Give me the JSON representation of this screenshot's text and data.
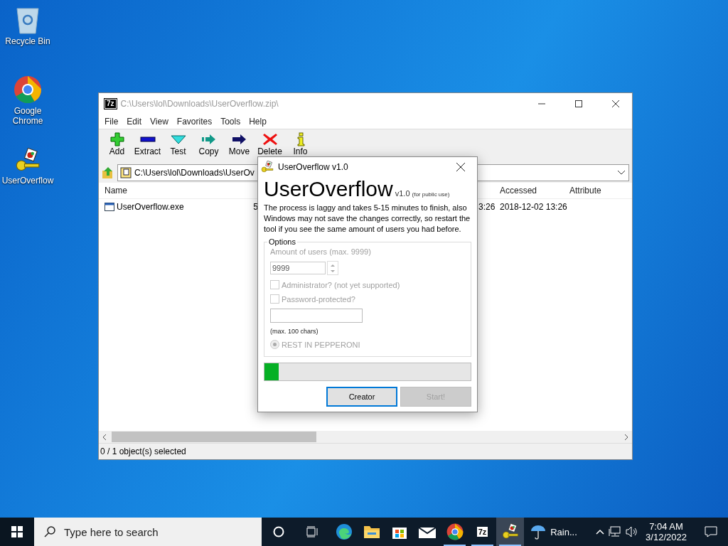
{
  "desktop_icons": [
    {
      "label": "Recycle Bin",
      "kind": "recycle"
    },
    {
      "label": "Google Chrome",
      "kind": "chrome"
    },
    {
      "label": "UserOverflow",
      "kind": "key"
    }
  ],
  "archive_window": {
    "logo": "7z",
    "title": "C:\\Users\\lol\\Downloads\\UserOverflow.zip\\",
    "menu": [
      "File",
      "Edit",
      "View",
      "Favorites",
      "Tools",
      "Help"
    ],
    "toolbar": [
      {
        "label": "Add",
        "kind": "add"
      },
      {
        "label": "Extract",
        "kind": "extract"
      },
      {
        "label": "Test",
        "kind": "test"
      },
      {
        "label": "Copy",
        "kind": "copy"
      },
      {
        "label": "Move",
        "kind": "move"
      },
      {
        "label": "Delete",
        "kind": "delete"
      },
      {
        "label": "Info",
        "kind": "info"
      }
    ],
    "address": "C:\\Users\\lol\\Downloads\\UserOv",
    "columns": {
      "name": "Name",
      "accessed": "Accessed",
      "attributes": "Attribute"
    },
    "rows": [
      {
        "name": "UserOverflow.exe",
        "column_2": "5",
        "column_3": "3:26",
        "accessed": "2018-12-02 13:26"
      }
    ],
    "status": "0 / 1 object(s) selected"
  },
  "dialog": {
    "title": "UserOverflow v1.0",
    "heading": "UserOverflow",
    "version": "v1.0",
    "note": "(for public use)",
    "message": "The process is laggy and takes 5-15 minutes to finish, also Windows may not save the changes correctly, so restart the tool if you see the same amount of users you had before.",
    "options_label": "Options",
    "amount_label": "Amount of users (max. 9999)",
    "amount_value": "9999",
    "checkboxes": [
      {
        "label": "Administrator? (not yet supported)",
        "checked": false,
        "disabled": true
      },
      {
        "label": "Password-protected?",
        "checked": false,
        "disabled": true
      }
    ],
    "password_hint": "(max. 100 chars)",
    "radio": {
      "label": "REST IN PEPPERONI",
      "selected": true,
      "disabled": true
    },
    "progress": {
      "level": 0.07
    },
    "buttons": [
      {
        "label": "Creator",
        "disabled": false,
        "default": true
      },
      {
        "label": "Start!",
        "disabled": true,
        "default": false
      }
    ]
  },
  "taskbar": {
    "search_placeholder": "Type here to search",
    "apps": [
      {
        "kind": "edge",
        "running": false,
        "selected": false
      },
      {
        "kind": "explorer",
        "running": false,
        "selected": false
      },
      {
        "kind": "store",
        "running": false,
        "selected": false
      },
      {
        "kind": "mail",
        "running": false,
        "selected": false
      },
      {
        "kind": "chrome",
        "running": true,
        "selected": false
      },
      {
        "kind": "sevenzip",
        "label": "7z",
        "running": true,
        "selected": false
      },
      {
        "kind": "key",
        "running": true,
        "selected": true
      }
    ],
    "weather": "Rain...",
    "time": "7:04 AM",
    "date": "3/12/2022"
  }
}
